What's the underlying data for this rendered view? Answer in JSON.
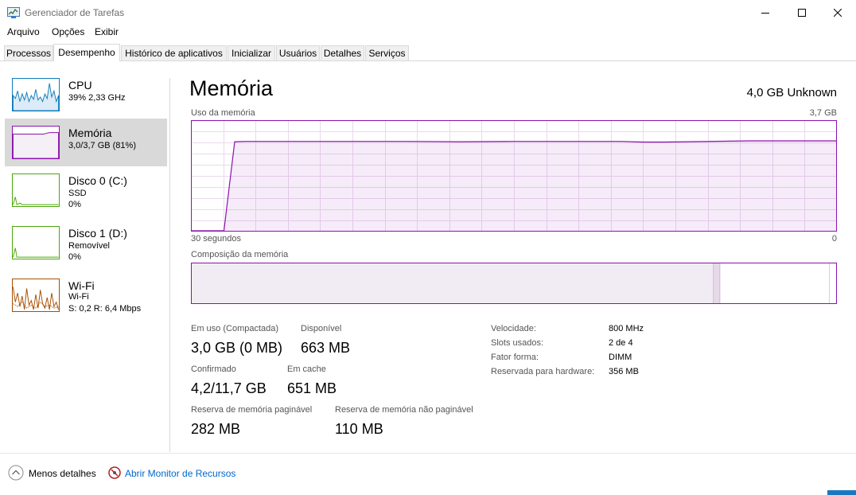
{
  "window": {
    "title": "Gerenciador de Tarefas"
  },
  "menu": [
    "Arquivo",
    "Opções",
    "Exibir"
  ],
  "tabs": [
    "Processos",
    "Desempenho",
    "Histórico de aplicativos",
    "Inicializar",
    "Usuários",
    "Detalhes",
    "Serviços"
  ],
  "active_tab": "Desempenho",
  "sidebar": {
    "items": [
      {
        "title": "CPU",
        "lines": [
          "39%  2,33 GHz"
        ],
        "color": "#117dbb"
      },
      {
        "title": "Memória",
        "lines": [
          "3,0/3,7 GB (81%)"
        ],
        "color": "#8b12ae"
      },
      {
        "title": "Disco 0 (C:)",
        "lines": [
          "SSD",
          "0%"
        ],
        "color": "#4da60c"
      },
      {
        "title": "Disco 1 (D:)",
        "lines": [
          "Removível",
          "0%"
        ],
        "color": "#4da60c"
      },
      {
        "title": "Wi-Fi",
        "lines": [
          "Wi-Fi",
          "S: 0,2  R: 6,4 Mbps"
        ],
        "color": "#a74f01"
      }
    ],
    "selected": "Memória"
  },
  "main": {
    "title": "Memória",
    "subtitle": "4,0 GB Unknown",
    "graph_label": "Uso da memória",
    "graph_max": "3,7 GB",
    "time_left": "30 segundos",
    "time_right": "0",
    "composition_label": "Composição da memória"
  },
  "stats": {
    "in_use_label": "Em uso (Compactada)",
    "in_use_value": "3,0 GB (0 MB)",
    "available_label": "Disponível",
    "available_value": "663 MB",
    "committed_label": "Confirmado",
    "committed_value": "4,2/11,7 GB",
    "cached_label": "Em cache",
    "cached_value": "651 MB",
    "paged_label": "Reserva de memória paginável",
    "paged_value": "282 MB",
    "nonpaged_label": "Reserva de memória não paginável",
    "nonpaged_value": "110 MB"
  },
  "details": {
    "speed_label": "Velocidade:",
    "speed_value": "800 MHz",
    "slots_label": "Slots usados:",
    "slots_value": "2 de 4",
    "form_label": "Fator forma:",
    "form_value": "DIMM",
    "reserved_label": "Reservada para hardware:",
    "reserved_value": "356 MB"
  },
  "footer": {
    "less_details": "Menos detalhes",
    "resource_monitor": "Abrir Monitor de Recursos"
  },
  "chart_data": {
    "type": "area",
    "title": "Uso da memória",
    "xlabel": "30 segundos",
    "ylabel": "",
    "xlim": [
      60,
      0
    ],
    "ylim": [
      0,
      3.7
    ],
    "x": [
      60,
      57,
      56,
      55,
      50,
      45,
      40,
      35,
      30,
      25,
      20,
      18,
      16,
      14,
      10,
      8,
      5,
      0
    ],
    "series": [
      {
        "values": [
          0,
          0,
          3.0,
          3.01,
          3.01,
          3.01,
          3.01,
          3.0,
          3.01,
          3.01,
          3.01,
          2.99,
          2.99,
          3.0,
          3.02,
          3.03,
          3.03,
          3.03
        ]
      }
    ],
    "composition": {
      "in_use": 81,
      "modified": 1,
      "standby": 17,
      "free": 1
    }
  }
}
